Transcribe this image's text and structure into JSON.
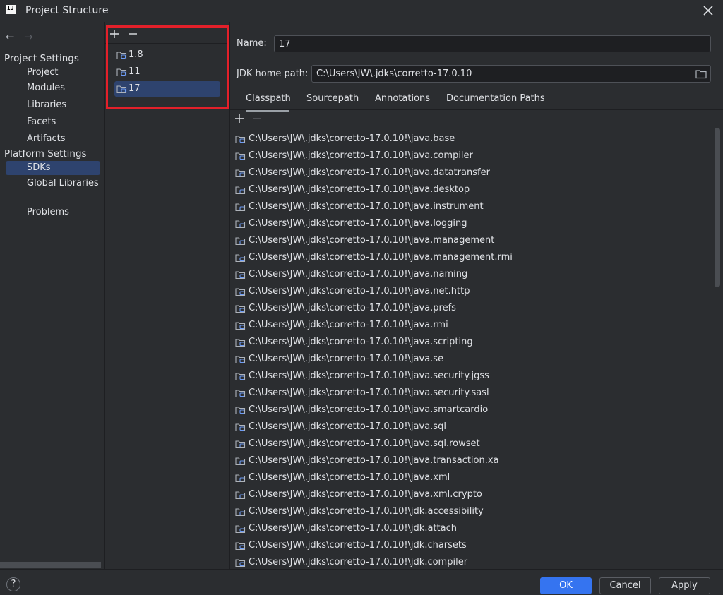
{
  "window": {
    "title": "Project Structure"
  },
  "sidebar": {
    "project_settings_header": "Project Settings",
    "project_items": [
      "Project",
      "Modules",
      "Libraries",
      "Facets",
      "Artifacts"
    ],
    "platform_settings_header": "Platform Settings",
    "platform_items": [
      "SDKs",
      "Global Libraries"
    ],
    "selected_item": "SDKs",
    "problems": "Problems"
  },
  "sdks": {
    "items": [
      "1.8",
      "11",
      "17"
    ],
    "selected": "17"
  },
  "details": {
    "name_label_pre": "Na",
    "name_label_mnemonic": "m",
    "name_label_post": "e:",
    "name_value": "17",
    "jdk_home_label": "JDK home path:",
    "jdk_home_value": "C:\\Users\\JW\\.jdks\\corretto-17.0.10",
    "tabs": [
      "Classpath",
      "Sourcepath",
      "Annotations",
      "Documentation Paths"
    ],
    "active_tab": "Classpath",
    "classpath": [
      "C:\\Users\\JW\\.jdks\\corretto-17.0.10!\\java.base",
      "C:\\Users\\JW\\.jdks\\corretto-17.0.10!\\java.compiler",
      "C:\\Users\\JW\\.jdks\\corretto-17.0.10!\\java.datatransfer",
      "C:\\Users\\JW\\.jdks\\corretto-17.0.10!\\java.desktop",
      "C:\\Users\\JW\\.jdks\\corretto-17.0.10!\\java.instrument",
      "C:\\Users\\JW\\.jdks\\corretto-17.0.10!\\java.logging",
      "C:\\Users\\JW\\.jdks\\corretto-17.0.10!\\java.management",
      "C:\\Users\\JW\\.jdks\\corretto-17.0.10!\\java.management.rmi",
      "C:\\Users\\JW\\.jdks\\corretto-17.0.10!\\java.naming",
      "C:\\Users\\JW\\.jdks\\corretto-17.0.10!\\java.net.http",
      "C:\\Users\\JW\\.jdks\\corretto-17.0.10!\\java.prefs",
      "C:\\Users\\JW\\.jdks\\corretto-17.0.10!\\java.rmi",
      "C:\\Users\\JW\\.jdks\\corretto-17.0.10!\\java.scripting",
      "C:\\Users\\JW\\.jdks\\corretto-17.0.10!\\java.se",
      "C:\\Users\\JW\\.jdks\\corretto-17.0.10!\\java.security.jgss",
      "C:\\Users\\JW\\.jdks\\corretto-17.0.10!\\java.security.sasl",
      "C:\\Users\\JW\\.jdks\\corretto-17.0.10!\\java.smartcardio",
      "C:\\Users\\JW\\.jdks\\corretto-17.0.10!\\java.sql",
      "C:\\Users\\JW\\.jdks\\corretto-17.0.10!\\java.sql.rowset",
      "C:\\Users\\JW\\.jdks\\corretto-17.0.10!\\java.transaction.xa",
      "C:\\Users\\JW\\.jdks\\corretto-17.0.10!\\java.xml",
      "C:\\Users\\JW\\.jdks\\corretto-17.0.10!\\java.xml.crypto",
      "C:\\Users\\JW\\.jdks\\corretto-17.0.10!\\jdk.accessibility",
      "C:\\Users\\JW\\.jdks\\corretto-17.0.10!\\jdk.attach",
      "C:\\Users\\JW\\.jdks\\corretto-17.0.10!\\jdk.charsets",
      "C:\\Users\\JW\\.jdks\\corretto-17.0.10!\\jdk.compiler"
    ]
  },
  "buttons": {
    "ok": "OK",
    "cancel": "Cancel",
    "apply": "Apply",
    "help": "?"
  },
  "icons": {
    "app": "intellij-logo-icon",
    "close": "close-icon",
    "back": "arrow-left-icon",
    "forward": "arrow-right-icon",
    "add": "plus-icon",
    "remove": "minus-icon",
    "sdk": "jdk-folder-icon",
    "browse": "folder-icon",
    "classpath_entry": "folder-icon"
  },
  "colors": {
    "background": "#2b2d30",
    "selection": "#2e436e",
    "accent": "#3574f0",
    "highlight_border": "#e3202a"
  }
}
